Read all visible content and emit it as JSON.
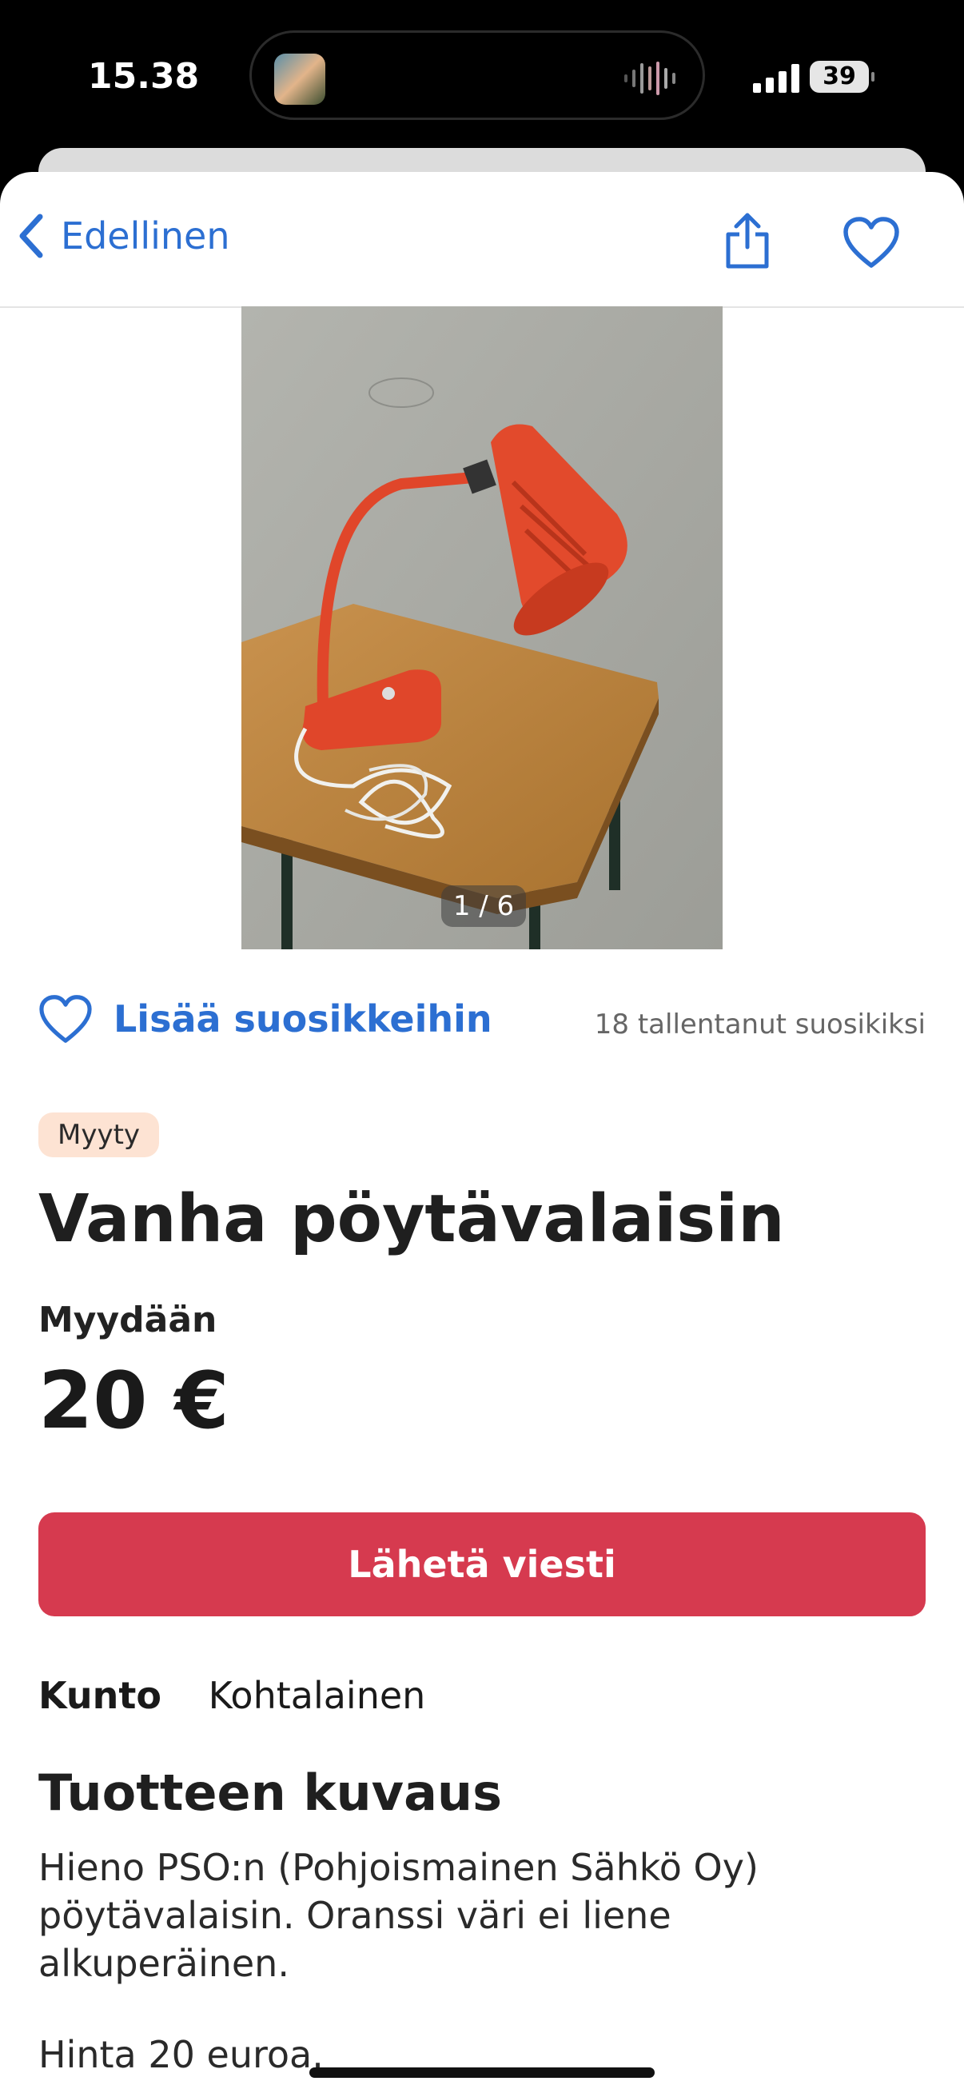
{
  "status_bar": {
    "time": "15.38",
    "battery": "39"
  },
  "nav": {
    "back_label": "Edellinen",
    "share_icon": "share-icon",
    "favorite_icon": "heart-outline-icon"
  },
  "gallery": {
    "counter": "1 / 6"
  },
  "favorites": {
    "add_label": "Lisää suosikkeihin",
    "saved_count_text": "18 tallentanut suosikiksi"
  },
  "listing": {
    "status_badge": "Myyty",
    "title": "Vanha pöytävalaisin",
    "sale_type": "Myydään",
    "price": "20 €",
    "send_message_label": "Lähetä viesti",
    "condition_label": "Kunto",
    "condition_value": "Kohtalainen",
    "description_heading": "Tuotteen kuvaus",
    "description_p1": "Hieno PSO:n (Pohjoismainen Sähkö Oy) pöytävalaisin. Oranssi väri ei liene alkuperäinen.",
    "description_p2": "Hinta 20 euroa."
  },
  "colors": {
    "accent_blue": "#2c6fd2",
    "button_red": "#d63a4f",
    "badge_bg": "#fde3d3"
  }
}
